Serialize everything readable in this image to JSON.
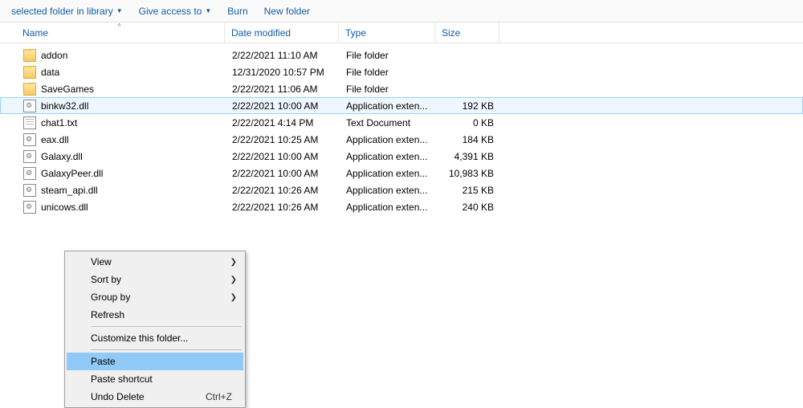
{
  "toolbar": {
    "include": "selected folder in library",
    "share": "Give access to",
    "burn": "Burn",
    "newfolder": "New folder"
  },
  "columns": {
    "name": "Name",
    "date": "Date modified",
    "type": "Type",
    "size": "Size"
  },
  "files": [
    {
      "name": "addon",
      "date": "2/22/2021 11:10 AM",
      "type": "File folder",
      "size": "",
      "icon": "folder",
      "selected": false
    },
    {
      "name": "data",
      "date": "12/31/2020 10:57 PM",
      "type": "File folder",
      "size": "",
      "icon": "folder",
      "selected": false
    },
    {
      "name": "SaveGames",
      "date": "2/22/2021 11:06 AM",
      "type": "File folder",
      "size": "",
      "icon": "folder",
      "selected": false
    },
    {
      "name": "binkw32.dll",
      "date": "2/22/2021 10:00 AM",
      "type": "Application exten...",
      "size": "192 KB",
      "icon": "dll",
      "selected": true
    },
    {
      "name": "chat1.txt",
      "date": "2/22/2021 4:14 PM",
      "type": "Text Document",
      "size": "0 KB",
      "icon": "file",
      "selected": false
    },
    {
      "name": "eax.dll",
      "date": "2/22/2021 10:25 AM",
      "type": "Application exten...",
      "size": "184 KB",
      "icon": "dll",
      "selected": false
    },
    {
      "name": "Galaxy.dll",
      "date": "2/22/2021 10:00 AM",
      "type": "Application exten...",
      "size": "4,391 KB",
      "icon": "dll",
      "selected": false
    },
    {
      "name": "GalaxyPeer.dll",
      "date": "2/22/2021 10:00 AM",
      "type": "Application exten...",
      "size": "10,983 KB",
      "icon": "dll",
      "selected": false
    },
    {
      "name": "steam_api.dll",
      "date": "2/22/2021 10:26 AM",
      "type": "Application exten...",
      "size": "215 KB",
      "icon": "dll",
      "selected": false
    },
    {
      "name": "unicows.dll",
      "date": "2/22/2021 10:26 AM",
      "type": "Application exten...",
      "size": "240 KB",
      "icon": "dll",
      "selected": false
    }
  ],
  "context_menu": [
    {
      "label": "View",
      "submenu": true
    },
    {
      "label": "Sort by",
      "submenu": true
    },
    {
      "label": "Group by",
      "submenu": true
    },
    {
      "label": "Refresh"
    },
    {
      "sep": true
    },
    {
      "label": "Customize this folder..."
    },
    {
      "sep": true
    },
    {
      "label": "Paste",
      "hover": true
    },
    {
      "label": "Paste shortcut"
    },
    {
      "label": "Undo Delete",
      "shortcut": "Ctrl+Z"
    }
  ]
}
